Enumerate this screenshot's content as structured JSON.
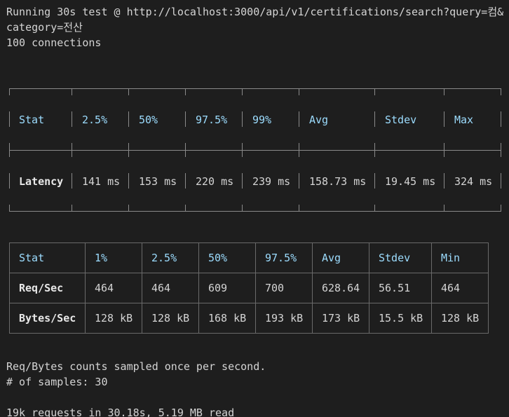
{
  "header": {
    "line1": "Running 30s test @ http://localhost:3000/api/v1/certifications/search?query=컴&",
    "line2": "category=전산",
    "line3": "100 connections"
  },
  "latency_table": {
    "headers": [
      "Stat",
      "2.5%",
      "50%",
      "97.5%",
      "99%",
      "Avg",
      "Stdev",
      "Max"
    ],
    "row": [
      "Latency",
      "141 ms",
      "153 ms",
      "220 ms",
      "239 ms",
      "158.73 ms",
      "19.45 ms",
      "324 ms"
    ]
  },
  "throughput_table": {
    "headers": [
      "Stat",
      "1%",
      "2.5%",
      "50%",
      "97.5%",
      "Avg",
      "Stdev",
      "Min"
    ],
    "rows": [
      [
        "Req/Sec",
        "464",
        "464",
        "609",
        "700",
        "628.64",
        "56.51",
        "464"
      ],
      [
        "Bytes/Sec",
        "128 kB",
        "128 kB",
        "168 kB",
        "193 kB",
        "173 kB",
        "15.5 kB",
        "128 kB"
      ]
    ]
  },
  "footer": {
    "line1": "Req/Bytes counts sampled once per second.",
    "line2": "# of samples: 30",
    "line3": "19k requests in 30.18s, 5.19 MB read"
  },
  "colors": {
    "background": "#1e1e1e",
    "text": "#d4d4d4",
    "header_cyan": "#9cdcfe",
    "border": "#8a8a8a"
  }
}
